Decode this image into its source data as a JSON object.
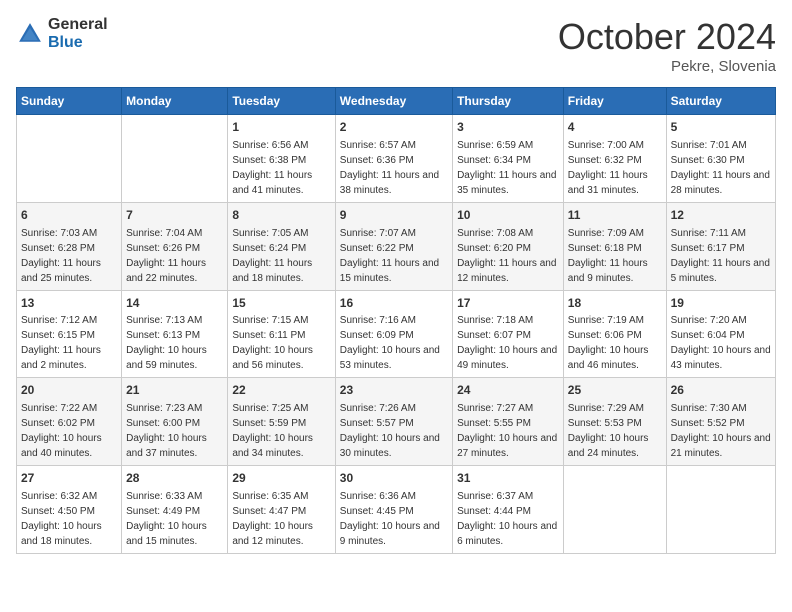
{
  "header": {
    "logo_general": "General",
    "logo_blue": "Blue",
    "month": "October 2024",
    "location": "Pekre, Slovenia"
  },
  "days_of_week": [
    "Sunday",
    "Monday",
    "Tuesday",
    "Wednesday",
    "Thursday",
    "Friday",
    "Saturday"
  ],
  "weeks": [
    [
      {
        "day": "",
        "content": ""
      },
      {
        "day": "",
        "content": ""
      },
      {
        "day": "1",
        "content": "Sunrise: 6:56 AM\nSunset: 6:38 PM\nDaylight: 11 hours and 41 minutes."
      },
      {
        "day": "2",
        "content": "Sunrise: 6:57 AM\nSunset: 6:36 PM\nDaylight: 11 hours and 38 minutes."
      },
      {
        "day": "3",
        "content": "Sunrise: 6:59 AM\nSunset: 6:34 PM\nDaylight: 11 hours and 35 minutes."
      },
      {
        "day": "4",
        "content": "Sunrise: 7:00 AM\nSunset: 6:32 PM\nDaylight: 11 hours and 31 minutes."
      },
      {
        "day": "5",
        "content": "Sunrise: 7:01 AM\nSunset: 6:30 PM\nDaylight: 11 hours and 28 minutes."
      }
    ],
    [
      {
        "day": "6",
        "content": "Sunrise: 7:03 AM\nSunset: 6:28 PM\nDaylight: 11 hours and 25 minutes."
      },
      {
        "day": "7",
        "content": "Sunrise: 7:04 AM\nSunset: 6:26 PM\nDaylight: 11 hours and 22 minutes."
      },
      {
        "day": "8",
        "content": "Sunrise: 7:05 AM\nSunset: 6:24 PM\nDaylight: 11 hours and 18 minutes."
      },
      {
        "day": "9",
        "content": "Sunrise: 7:07 AM\nSunset: 6:22 PM\nDaylight: 11 hours and 15 minutes."
      },
      {
        "day": "10",
        "content": "Sunrise: 7:08 AM\nSunset: 6:20 PM\nDaylight: 11 hours and 12 minutes."
      },
      {
        "day": "11",
        "content": "Sunrise: 7:09 AM\nSunset: 6:18 PM\nDaylight: 11 hours and 9 minutes."
      },
      {
        "day": "12",
        "content": "Sunrise: 7:11 AM\nSunset: 6:17 PM\nDaylight: 11 hours and 5 minutes."
      }
    ],
    [
      {
        "day": "13",
        "content": "Sunrise: 7:12 AM\nSunset: 6:15 PM\nDaylight: 11 hours and 2 minutes."
      },
      {
        "day": "14",
        "content": "Sunrise: 7:13 AM\nSunset: 6:13 PM\nDaylight: 10 hours and 59 minutes."
      },
      {
        "day": "15",
        "content": "Sunrise: 7:15 AM\nSunset: 6:11 PM\nDaylight: 10 hours and 56 minutes."
      },
      {
        "day": "16",
        "content": "Sunrise: 7:16 AM\nSunset: 6:09 PM\nDaylight: 10 hours and 53 minutes."
      },
      {
        "day": "17",
        "content": "Sunrise: 7:18 AM\nSunset: 6:07 PM\nDaylight: 10 hours and 49 minutes."
      },
      {
        "day": "18",
        "content": "Sunrise: 7:19 AM\nSunset: 6:06 PM\nDaylight: 10 hours and 46 minutes."
      },
      {
        "day": "19",
        "content": "Sunrise: 7:20 AM\nSunset: 6:04 PM\nDaylight: 10 hours and 43 minutes."
      }
    ],
    [
      {
        "day": "20",
        "content": "Sunrise: 7:22 AM\nSunset: 6:02 PM\nDaylight: 10 hours and 40 minutes."
      },
      {
        "day": "21",
        "content": "Sunrise: 7:23 AM\nSunset: 6:00 PM\nDaylight: 10 hours and 37 minutes."
      },
      {
        "day": "22",
        "content": "Sunrise: 7:25 AM\nSunset: 5:59 PM\nDaylight: 10 hours and 34 minutes."
      },
      {
        "day": "23",
        "content": "Sunrise: 7:26 AM\nSunset: 5:57 PM\nDaylight: 10 hours and 30 minutes."
      },
      {
        "day": "24",
        "content": "Sunrise: 7:27 AM\nSunset: 5:55 PM\nDaylight: 10 hours and 27 minutes."
      },
      {
        "day": "25",
        "content": "Sunrise: 7:29 AM\nSunset: 5:53 PM\nDaylight: 10 hours and 24 minutes."
      },
      {
        "day": "26",
        "content": "Sunrise: 7:30 AM\nSunset: 5:52 PM\nDaylight: 10 hours and 21 minutes."
      }
    ],
    [
      {
        "day": "27",
        "content": "Sunrise: 6:32 AM\nSunset: 4:50 PM\nDaylight: 10 hours and 18 minutes."
      },
      {
        "day": "28",
        "content": "Sunrise: 6:33 AM\nSunset: 4:49 PM\nDaylight: 10 hours and 15 minutes."
      },
      {
        "day": "29",
        "content": "Sunrise: 6:35 AM\nSunset: 4:47 PM\nDaylight: 10 hours and 12 minutes."
      },
      {
        "day": "30",
        "content": "Sunrise: 6:36 AM\nSunset: 4:45 PM\nDaylight: 10 hours and 9 minutes."
      },
      {
        "day": "31",
        "content": "Sunrise: 6:37 AM\nSunset: 4:44 PM\nDaylight: 10 hours and 6 minutes."
      },
      {
        "day": "",
        "content": ""
      },
      {
        "day": "",
        "content": ""
      }
    ]
  ]
}
